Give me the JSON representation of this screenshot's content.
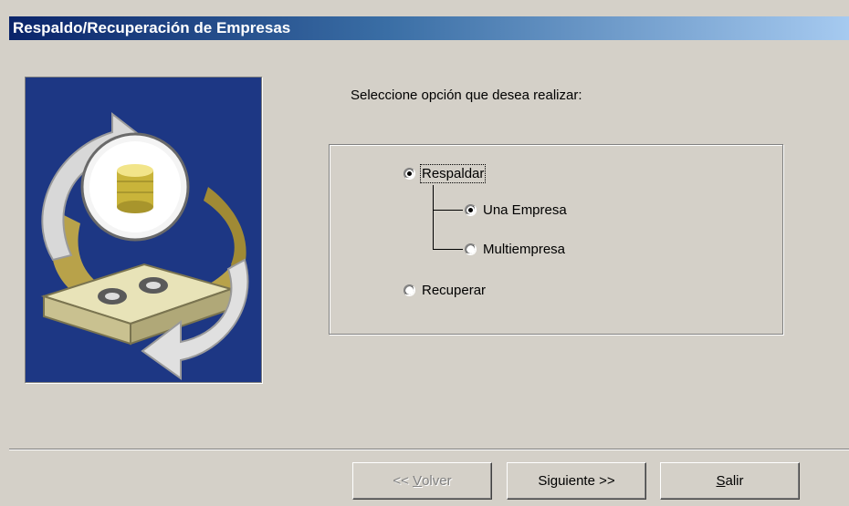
{
  "window": {
    "title": "Respaldo/Recuperación de Empresas"
  },
  "prompt": "Seleccione opción que desea realizar:",
  "options": {
    "respaldar": {
      "label": "Respaldar",
      "checked": true
    },
    "una_empresa": {
      "label": "Una Empresa",
      "checked": true
    },
    "multiempresa": {
      "label": "Multiempresa",
      "checked": false
    },
    "recuperar": {
      "label": "Recuperar",
      "checked": false
    }
  },
  "buttons": {
    "volver": {
      "prefix": "<< ",
      "accel": "V",
      "rest": "olver",
      "enabled": false
    },
    "siguiente": {
      "prefix": "Si",
      "accel": "g",
      "rest": "uiente >>",
      "enabled": true
    },
    "salir": {
      "prefix": "",
      "accel": "S",
      "rest": "alir",
      "enabled": true
    }
  },
  "image": {
    "description_icon": "backup-restore-illustration-icon"
  },
  "colors": {
    "title_start": "#0a246a",
    "title_end": "#a6caf0",
    "face": "#d4d0c8",
    "picture_bg": "#1d3784"
  }
}
